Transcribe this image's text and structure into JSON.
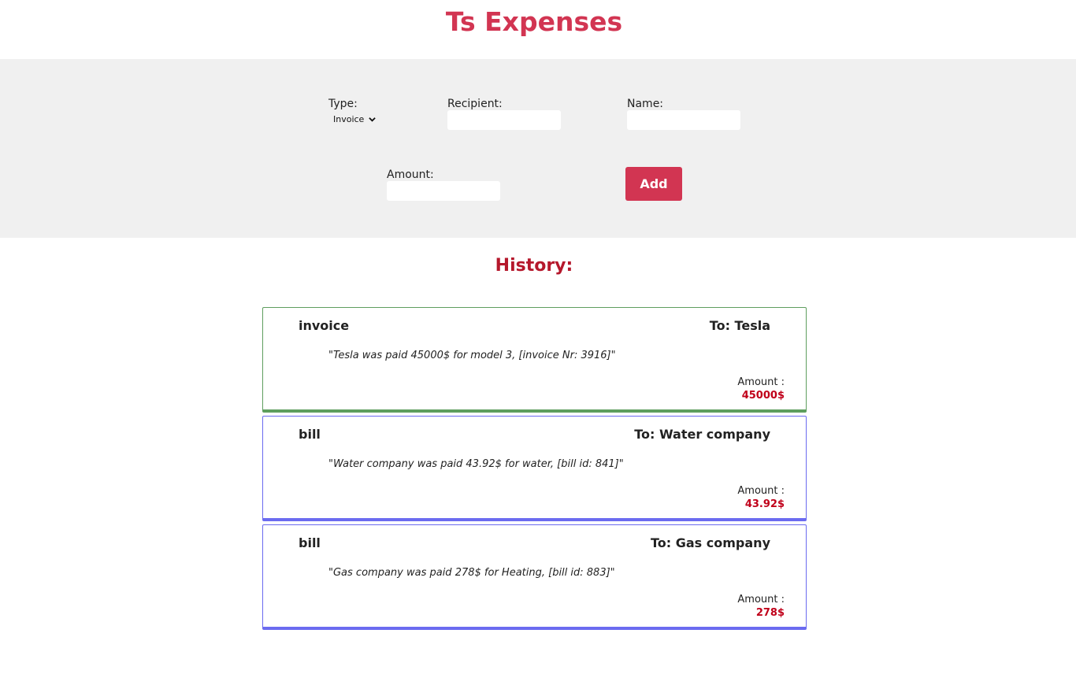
{
  "app": {
    "title": "Ts Expenses"
  },
  "form": {
    "type_label": "Type:",
    "type_value": "Invoice",
    "recipient_label": "Recipient:",
    "recipient_value": "",
    "name_label": "Name:",
    "name_value": "",
    "amount_label": "Amount:",
    "amount_value": "",
    "add_label": "Add"
  },
  "history": {
    "title": "History:",
    "amount_label": "Amount :",
    "items": [
      {
        "type": "invoice",
        "to": "To: Tesla",
        "description": "\"Tesla was paid 45000$ for model 3, [invoice Nr: 3916]\"",
        "amount": "45000$",
        "accent": "#5e9e5e"
      },
      {
        "type": "bill",
        "to": "To: Water company",
        "description": "\"Water company was paid 43.92$ for water, [bill id: 841]\"",
        "amount": "43.92$",
        "accent": "#6b6bf0"
      },
      {
        "type": "bill",
        "to": "To: Gas company",
        "description": "\"Gas company was paid 278$ for Heating, [bill id: 883]\"",
        "amount": "278$",
        "accent": "#6b6bf0"
      }
    ]
  },
  "colors": {
    "brand": "#d23552",
    "history_title": "#b5182c",
    "amount": "#c0001a",
    "panel_bg": "#f0f0f0"
  }
}
